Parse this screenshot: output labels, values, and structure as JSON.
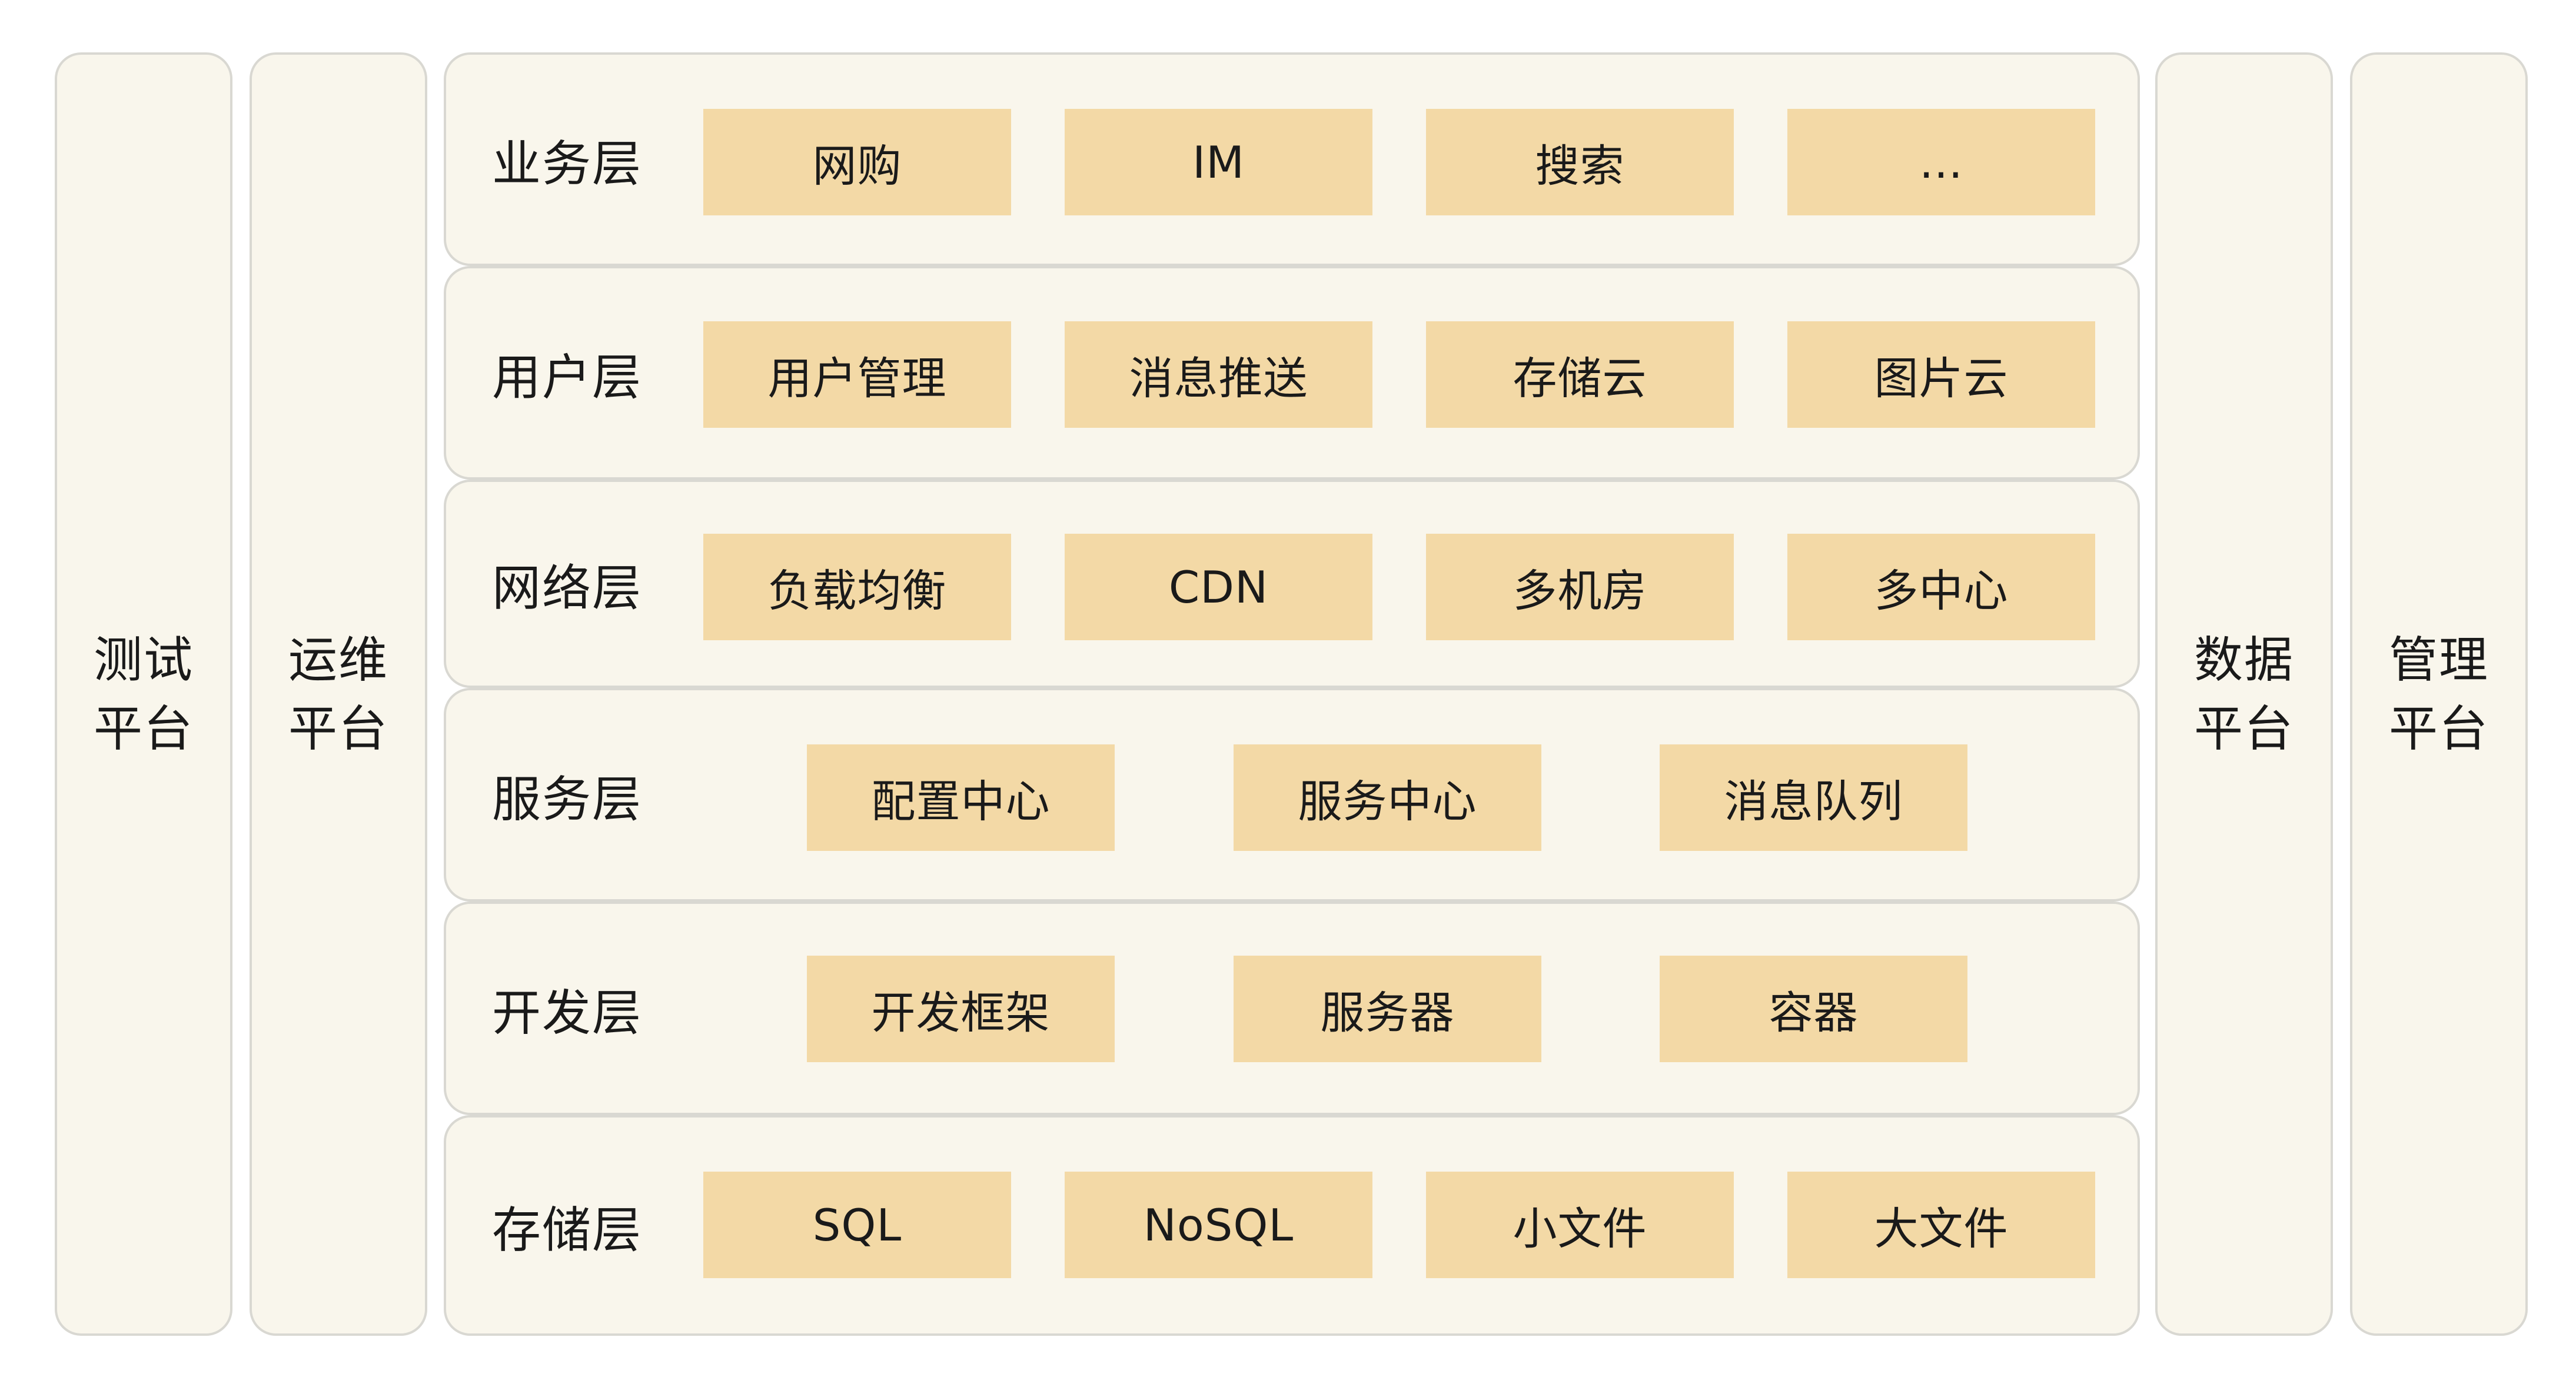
{
  "platforms": {
    "test": [
      "测试",
      "平台"
    ],
    "ops": [
      "运维",
      "平台"
    ],
    "data": [
      "数据",
      "平台"
    ],
    "mgmt": [
      "管理",
      "平台"
    ]
  },
  "layers": [
    {
      "label": "业务层",
      "modules": [
        "网购",
        "IM",
        "搜索",
        "..."
      ]
    },
    {
      "label": "用户层",
      "modules": [
        "用户管理",
        "消息推送",
        "存储云",
        "图片云"
      ]
    },
    {
      "label": "网络层",
      "modules": [
        "负载均衡",
        "CDN",
        "多机房",
        "多中心"
      ]
    },
    {
      "label": "服务层",
      "modules": [
        "配置中心",
        "服务中心",
        "消息队列"
      ]
    },
    {
      "label": "开发层",
      "modules": [
        "开发框架",
        "服务器",
        "容器"
      ]
    },
    {
      "label": "存储层",
      "modules": [
        "SQL",
        "NoSQL",
        "小文件",
        "大文件"
      ]
    }
  ],
  "colors": {
    "panel_bg": "#f9f6ec",
    "panel_border": "#d9d8d2",
    "module_bg": "#f3d9a6"
  }
}
